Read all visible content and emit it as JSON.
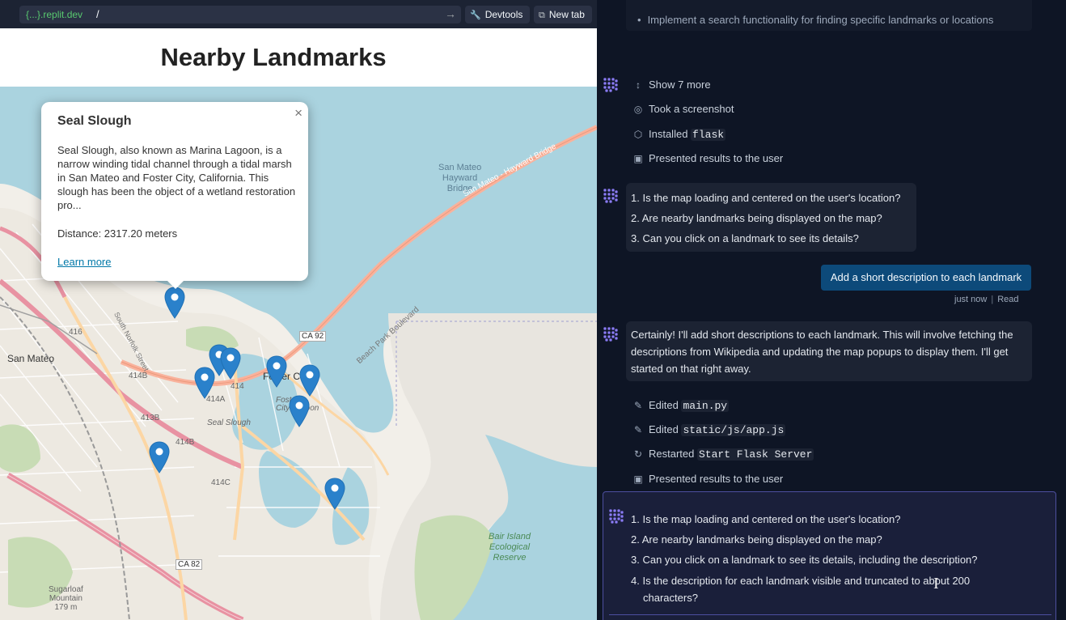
{
  "browser": {
    "domain": "{...}.replit.dev",
    "path": "/",
    "devtools_label": "Devtools",
    "newtab_label": "New tab"
  },
  "page": {
    "title": "Nearby Landmarks"
  },
  "map": {
    "labels": {
      "san_mateo": "San Mateo",
      "foster_city": "Foster Ci",
      "bridge": "San Mateo\nHayward\nBridge",
      "bridge_road": "San Mateo - Hayward Bridge",
      "bair_island": "Bair Island\nEcological\nReserve",
      "sugarloaf": "Sugarloaf\nMountain\n179 m",
      "seal_slough": "Seal Slough",
      "foster_lagoon": "Foster\nCity Lagoon",
      "ca92": "CA 92",
      "ca82": "CA 82",
      "r416": "416",
      "r414b": "414B",
      "r413b": "413B",
      "r414a": "414A",
      "r414b2": "414B",
      "r414c": "414C",
      "r414": "414",
      "beach_park": "Beach Park Boulevard",
      "south_norfolk": "South Norfolk Street"
    },
    "marker_count": 9
  },
  "popup": {
    "title": "Seal Slough",
    "close": "×",
    "description": "Seal Slough, also known as Marina Lagoon, is a narrow winding tidal channel through a tidal marsh in San Mateo and Foster City, California. This slough has been the object of a wetland restoration pro...",
    "distance": "Distance: 2317.20 meters",
    "link": "Learn more"
  },
  "chat": {
    "bullet": "Implement a search functionality for finding specific landmarks or locations",
    "steps_1": [
      {
        "icon": "↕",
        "name": "show-more",
        "text": "Show 7 more",
        "code": ""
      },
      {
        "icon": "◎",
        "name": "screenshot",
        "text": "Took a screenshot",
        "code": ""
      },
      {
        "icon": "⬡",
        "name": "package",
        "text": "Installed ",
        "code": "flask"
      },
      {
        "icon": "▣",
        "name": "present",
        "text": "Presented results to the user",
        "code": ""
      }
    ],
    "questions_1": [
      "1. Is the map loading and centered on the user's location?",
      "2. Are nearby landmarks being displayed on the map?",
      "3. Can you click on a landmark to see its details?"
    ],
    "user_message": "Add a short description to each landmark",
    "meta_time": "just now",
    "meta_status": "Read",
    "agent_reply": "Certainly! I'll add short descriptions to each landmark. This will involve fetching the descriptions from Wikipedia and updating the map popups to display them. I'll get started on that right away.",
    "steps_2": [
      {
        "icon": "✎",
        "name": "edit",
        "text": "Edited ",
        "code": "main.py"
      },
      {
        "icon": "✎",
        "name": "edit",
        "text": "Edited ",
        "code": "static/js/app.js"
      },
      {
        "icon": "↻",
        "name": "restart",
        "text": "Restarted ",
        "code": "Start Flask Server"
      },
      {
        "icon": "▣",
        "name": "present",
        "text": "Presented results to the user",
        "code": ""
      }
    ],
    "questions_2": [
      "1. Is the map loading and centered on the user's location?",
      "2. Are nearby landmarks being displayed on the map?",
      "3. Can you click on a landmark to see its details, including the description?",
      "4. Is the description for each landmark visible and truncated to about 200",
      "characters?"
    ]
  },
  "colors": {
    "marker": "#2a81cb",
    "water": "#aad3df",
    "user_bubble": "#0d4a7a",
    "chat_bg": "#0e1525"
  }
}
